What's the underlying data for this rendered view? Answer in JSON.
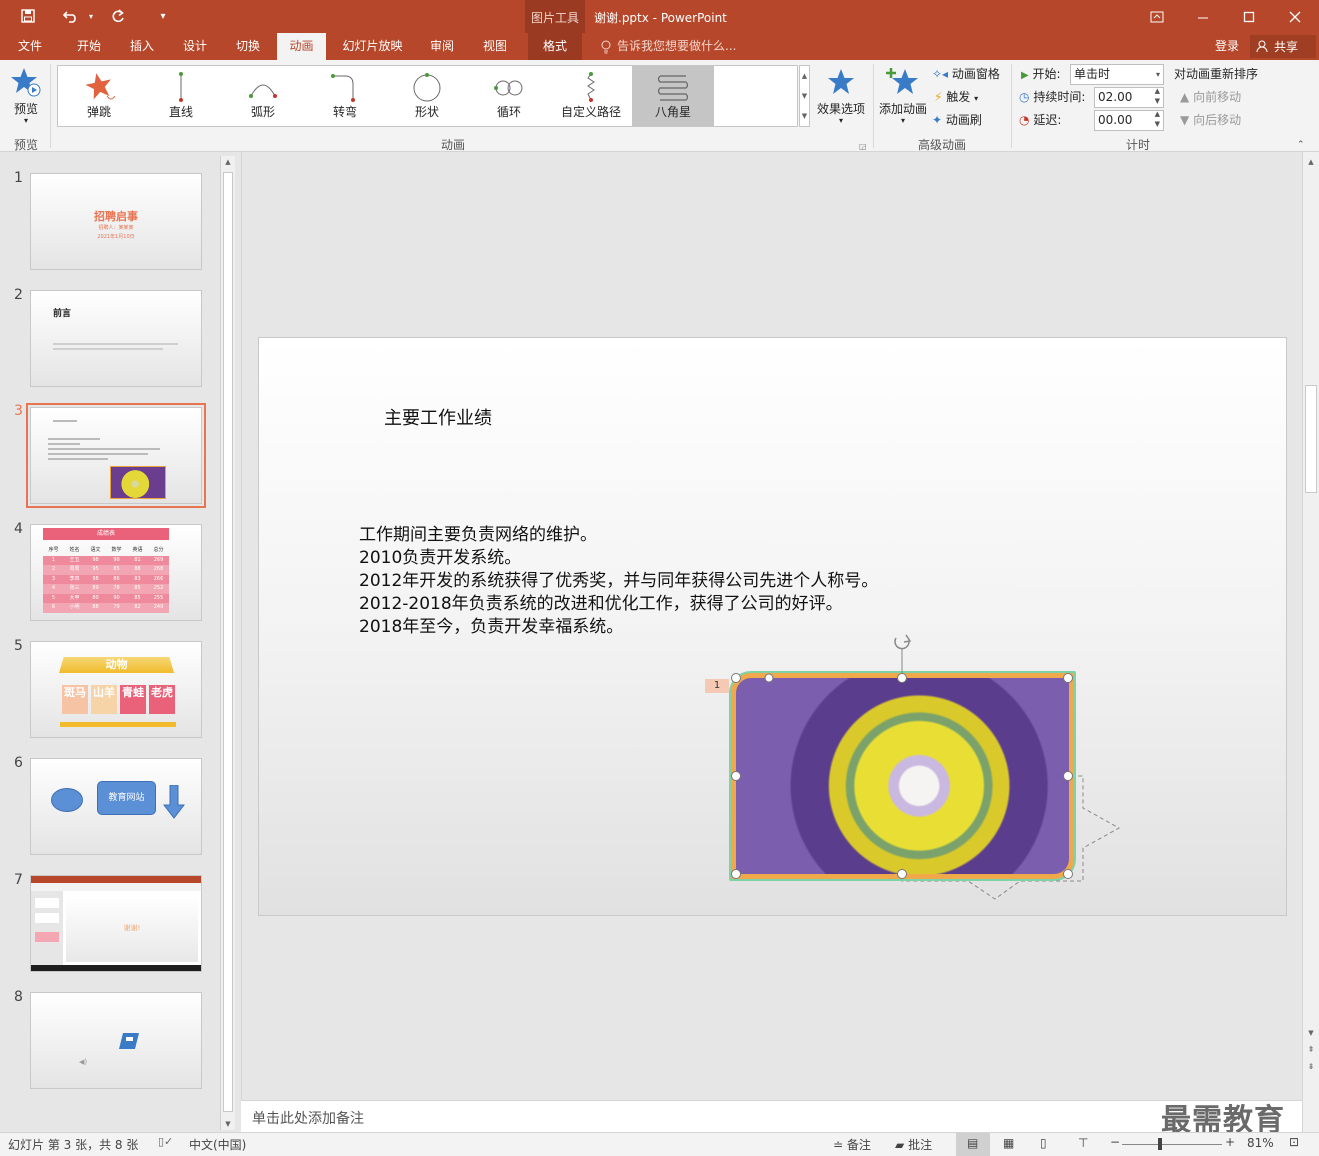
{
  "window": {
    "title": "谢谢.pptx - PowerPoint",
    "context_tool": "图片工具"
  },
  "tabs": {
    "file": "文件",
    "home": "开始",
    "insert": "插入",
    "design": "设计",
    "transitions": "切换",
    "animations": "动画",
    "slideshow": "幻灯片放映",
    "review": "审阅",
    "view": "视图",
    "format": "格式",
    "tell_me": "告诉我您想要做什么...",
    "signin": "登录",
    "share": "共享"
  },
  "ribbon": {
    "preview_label": "预览",
    "preview_group": "预览",
    "animation_group": "动画",
    "gallery": [
      {
        "label": "弹跳",
        "icon": "bounce-star-icon"
      },
      {
        "label": "直线",
        "icon": "line-path-icon"
      },
      {
        "label": "弧形",
        "icon": "arc-path-icon"
      },
      {
        "label": "转弯",
        "icon": "turn-path-icon"
      },
      {
        "label": "形状",
        "icon": "shape-path-icon"
      },
      {
        "label": "循环",
        "icon": "loop-path-icon"
      },
      {
        "label": "自定义路径",
        "icon": "custom-path-icon"
      },
      {
        "label": "八角星",
        "icon": "octagon-star-icon"
      }
    ],
    "effect_options": "效果选项",
    "add_animation": "添加动画",
    "animation_pane": "动画窗格",
    "trigger": "触发",
    "animation_painter": "动画刷",
    "advanced_group": "高级动画",
    "start_label": "开始:",
    "start_value": "单击时",
    "duration_label": "持续时间:",
    "duration_value": "02.00",
    "delay_label": "延迟:",
    "delay_value": "00.00",
    "reorder": "对动画重新排序",
    "move_earlier": "向前移动",
    "move_later": "向后移动",
    "timing_group": "计时"
  },
  "thumbnails": {
    "numbers": [
      "1",
      "2",
      "3",
      "4",
      "5",
      "6",
      "7",
      "8"
    ],
    "s1_title": "招聘启事",
    "s1_sub": "招聘人：某某某",
    "s1_date": "2021年1月10日",
    "s2_title": "前言",
    "s4_title": "成绩表",
    "s4_headers": [
      "序号",
      "姓名",
      "语文",
      "数学",
      "英语",
      "总分"
    ],
    "s4_rows": [
      [
        "1",
        "王五",
        "98",
        "90",
        "81",
        "269"
      ],
      [
        "2",
        "周周",
        "95",
        "85",
        "88",
        "268"
      ],
      [
        "3",
        "李四",
        "98",
        "86",
        "83",
        "266"
      ],
      [
        "4",
        "张三",
        "89",
        "78",
        "85",
        "252"
      ],
      [
        "5",
        "大甲",
        "80",
        "90",
        "85",
        "255"
      ],
      [
        "6",
        "小明",
        "88",
        "79",
        "82",
        "249"
      ]
    ],
    "s5_title": "动物",
    "s5_cards": [
      "斑马",
      "山羊",
      "青蛙",
      "老虎"
    ],
    "s6_box": "教育网站",
    "s7_text": "谢谢!"
  },
  "slide": {
    "title": "主要工作业绩",
    "body": [
      "工作期间主要负责网络的维护。",
      "2010负责开发系统。",
      "2012年开发的系统获得了优秀奖，并与同年获得公司先进个人称号。",
      "2012-2018年负责系统的改进和优化工作，获得了公司的好评。",
      "2018年至今，负责开发幸福系统。"
    ],
    "anim_tag": "1"
  },
  "notes_placeholder": "单击此处添加备注",
  "status": {
    "slide_info": "幻灯片 第 3 张，共 8 张",
    "language": "中文(中国)",
    "notes": "备注",
    "comments": "批注",
    "zoom": "81%",
    "watermark": "最需教育"
  },
  "colors": {
    "accent": "#b7472a",
    "selection": "#e97452"
  }
}
